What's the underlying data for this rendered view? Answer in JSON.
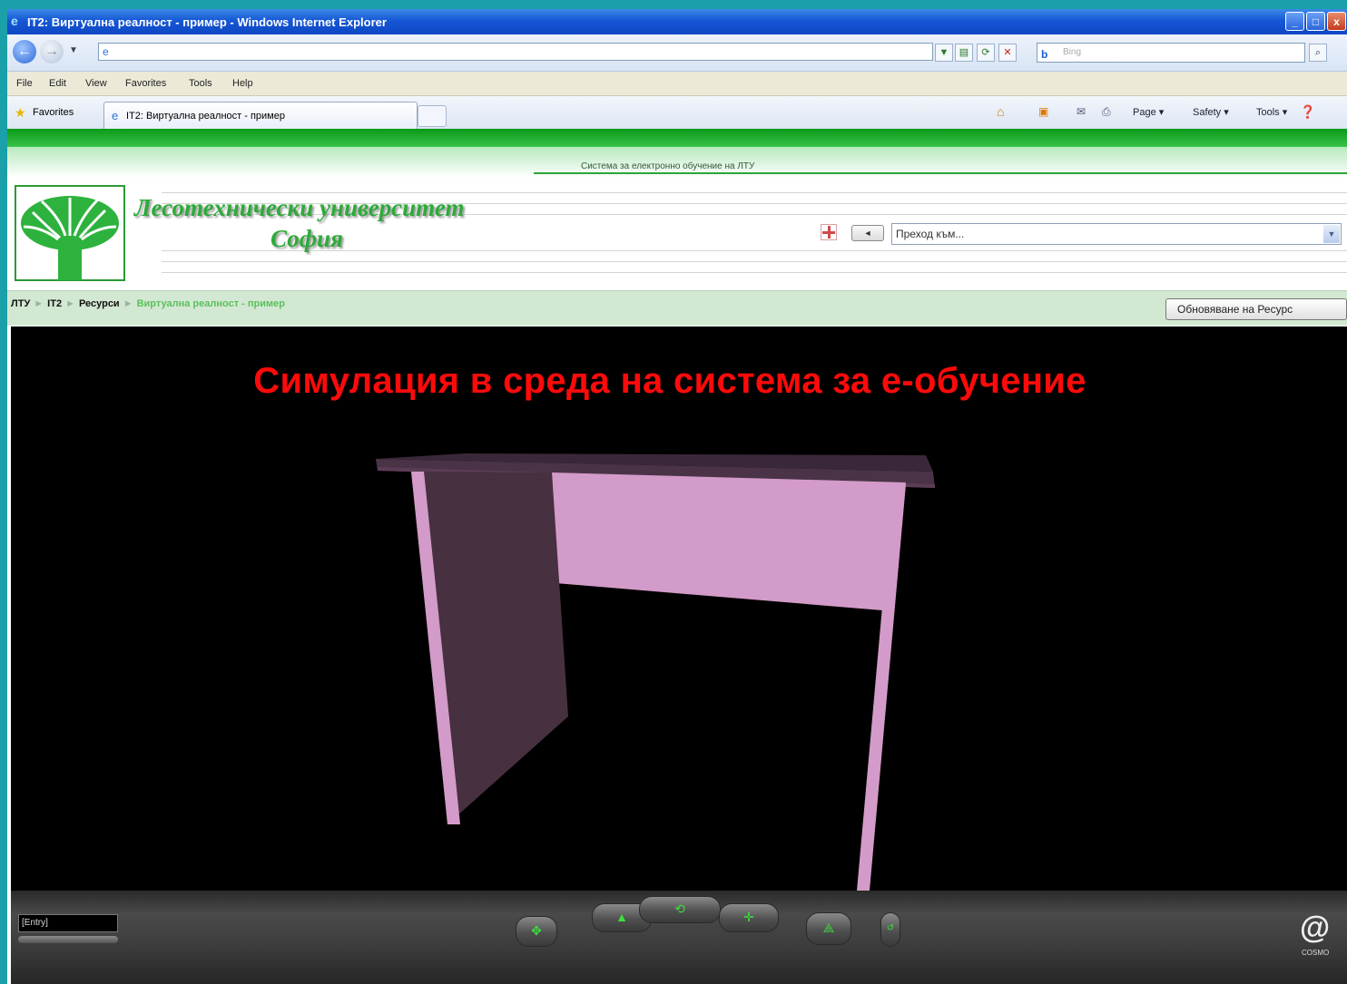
{
  "window": {
    "title": "IT2: Виртуална реалност - пример - Windows Internet Explorer",
    "controls": {
      "minimize": "_",
      "maximize": "□",
      "close": "x"
    }
  },
  "toolbar": {
    "back_icon": "back-arrow-icon",
    "forward_icon": "forward-arrow-icon",
    "address_value": "",
    "search_engine": "b",
    "search_placeholder": "Bing"
  },
  "menu": [
    "File",
    "Edit",
    "View",
    "Favorites",
    "Tools",
    "Help"
  ],
  "favorites_bar": {
    "favorites_label": "Favorites",
    "tab_label": "IT2: Виртуална реалност - пример",
    "commands": [
      "Page ▾",
      "Safety ▾",
      "Tools ▾"
    ]
  },
  "site": {
    "system_caption": "Система за електронно обучение на ЛТУ",
    "university_line1": "Лесотехнически университет",
    "university_line2": "София",
    "jump_placeholder": "Преход към...",
    "prev_label": "◄",
    "breadcrumb": [
      "ЛТУ",
      "IT2",
      "Ресурси",
      "Виртуална реалност - пример"
    ],
    "breadcrumb_sep": "►",
    "update_button": "Обновяване на Ресурс",
    "accent_green": "#2eaa3a"
  },
  "viewer": {
    "title": "Симулация в среда на система за е-обучение",
    "title_color": "#ff0a0a",
    "model": {
      "top_color": "#4a3347",
      "front_color": "#d39bc9",
      "side_color": "#47303f"
    },
    "entry_label": "[Entry]",
    "brand": "COSMO"
  }
}
